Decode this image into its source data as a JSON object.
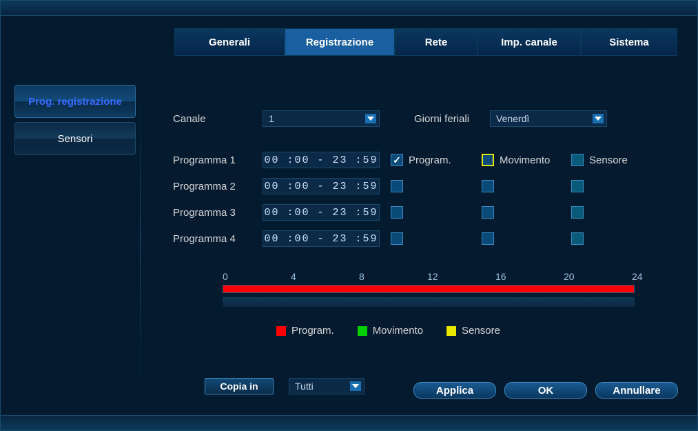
{
  "tabs": {
    "general": "Generali",
    "recording": "Registrazione",
    "network": "Rete",
    "channel_settings": "Imp. canale",
    "system": "Sistema"
  },
  "sidebar": {
    "rec_schedule": "Prog. registrazione",
    "sensors": "Sensori"
  },
  "labels": {
    "channel": "Canale",
    "weekday": "Giorni feriali",
    "program1": "Programma 1",
    "program2": "Programma 2",
    "program3": "Programma 3",
    "program4": "Programma 4",
    "program_col": "Program.",
    "motion_col": "Movimento",
    "sensor_col": "Sensore",
    "copy_to": "Copia in"
  },
  "values": {
    "channel": "1",
    "weekday": "Venerdì",
    "copy_target": "Tutti"
  },
  "times": {
    "p1": "00 :00 - 23 :59",
    "p2": "00 :00 - 23 :59",
    "p3": "00 :00 - 23 :59",
    "p4": "00 :00 - 23 :59"
  },
  "checks": {
    "p1": {
      "program": true,
      "motion": false,
      "sensor": false
    },
    "p2": {
      "program": false,
      "motion": false,
      "sensor": false
    },
    "p3": {
      "program": false,
      "motion": false,
      "sensor": false
    },
    "p4": {
      "program": false,
      "motion": false,
      "sensor": false
    }
  },
  "timeline": {
    "ticks": [
      "0",
      "4",
      "8",
      "12",
      "16",
      "20",
      "24"
    ],
    "fill_start_h": 0,
    "fill_end_h": 24
  },
  "legend": {
    "program": "Program.",
    "motion": "Movimento",
    "sensor": "Sensore"
  },
  "footer": {
    "apply": "Applica",
    "ok": "OK",
    "cancel": "Annullare"
  },
  "colors": {
    "accent": "#1a5fa0",
    "program": "#ff0000",
    "motion": "#00d000",
    "sensor": "#e8e800"
  }
}
